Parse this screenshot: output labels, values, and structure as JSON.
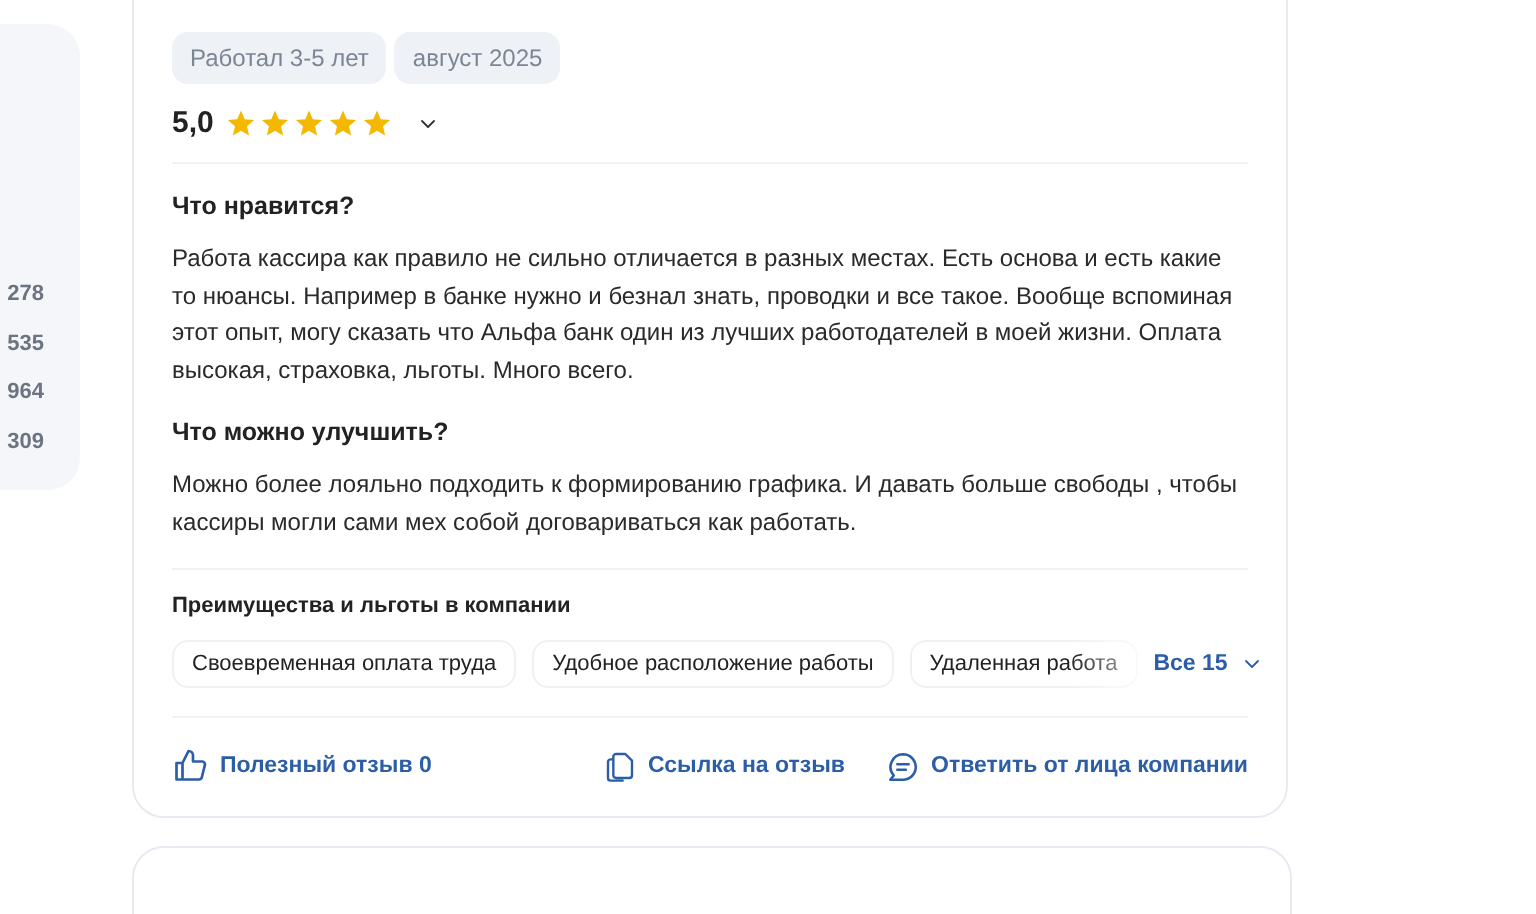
{
  "sidebar": {
    "counts": [
      "278",
      "535",
      "964",
      "309"
    ]
  },
  "review": {
    "tags": [
      "Работал 3-5 лет",
      "август 2025"
    ],
    "rating": "5,0",
    "stars": 5,
    "sections": [
      {
        "title": "Что нравится?",
        "text": "Работа кассира как правило не сильно отличается в разных местах. Есть основа и есть какие то нюансы. Например в банке нужно и безнал знать, проводки и все такое. Вообще вспоминая этот опыт, могу сказать что Альфа банк один из лучших работодателей в моей жизни. Оплата высокая, страховка, льготы. Много всего."
      },
      {
        "title": "Что можно улучшить?",
        "text": "Можно более лояльно подходить к формированию графика. И давать больше свободы , чтобы кассиры могли сами мех собой договариваться как работать."
      }
    ],
    "benefits": {
      "title": "Преимущества и льготы в компании",
      "items": [
        "Своевременная оплата труда",
        "Удобное расположение работы",
        "Удаленная работа"
      ],
      "more": "Все 15"
    },
    "actions": {
      "useful": "Полезный отзыв 0",
      "link": "Ссылка на отзыв",
      "reply": "Ответить от лица компании"
    }
  }
}
